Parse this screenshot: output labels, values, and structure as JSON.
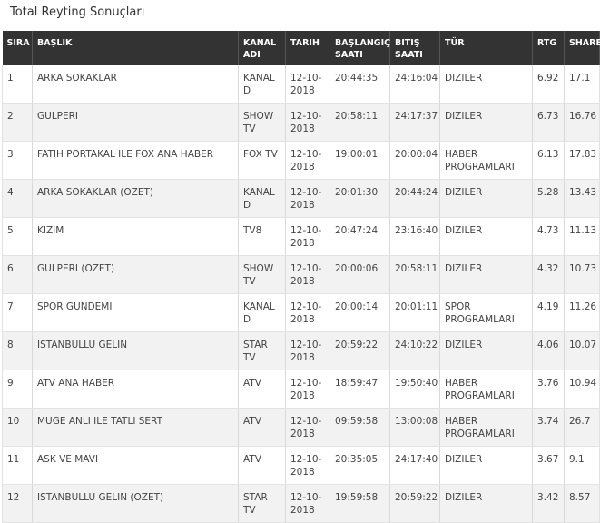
{
  "title": "Total Reyting Sonuçları",
  "headers": [
    "SIRA",
    "BAŞLIK",
    "KANAL ADI",
    "TARIH",
    "BAŞLANGIÇ SAATI",
    "BITIŞ SAATI",
    "TÜR",
    "RTG",
    "SHARE"
  ],
  "rows": [
    [
      "1",
      "ARKA SOKAKLAR",
      "KANAL D",
      "12-10-2018",
      "20:44:35",
      "24:16:04",
      "DIZILER",
      "6.92",
      "17.1"
    ],
    [
      "2",
      "GULPERI",
      "SHOW TV",
      "12-10-2018",
      "20:58:11",
      "24:17:37",
      "DIZILER",
      "6.73",
      "16.76"
    ],
    [
      "3",
      "FATIH PORTAKAL ILE FOX ANA HABER",
      "FOX TV",
      "12-10-2018",
      "19:00:01",
      "20:00:04",
      "HABER PROGRAMLARI",
      "6.13",
      "17.83"
    ],
    [
      "4",
      "ARKA SOKAKLAR (OZET)",
      "KANAL D",
      "12-10-2018",
      "20:01:30",
      "20:44:24",
      "DIZILER",
      "5.28",
      "13.43"
    ],
    [
      "5",
      "KIZIM",
      "TV8",
      "12-10-2018",
      "20:47:24",
      "23:16:40",
      "DIZILER",
      "4.73",
      "11.13"
    ],
    [
      "6",
      "GULPERI (OZET)",
      "SHOW TV",
      "12-10-2018",
      "20:00:06",
      "20:58:11",
      "DIZILER",
      "4.32",
      "10.73"
    ],
    [
      "7",
      "SPOR GUNDEMI",
      "KANAL D",
      "12-10-2018",
      "20:00:14",
      "20:01:11",
      "SPOR PROGRAMLARI",
      "4.19",
      "11.26"
    ],
    [
      "8",
      "ISTANBULLU GELIN",
      "STAR TV",
      "12-10-2018",
      "20:59:22",
      "24:10:22",
      "DIZILER",
      "4.06",
      "10.07"
    ],
    [
      "9",
      "ATV ANA HABER",
      "ATV",
      "12-10-2018",
      "18:59:47",
      "19:50:40",
      "HABER PROGRAMLARI",
      "3.76",
      "10.94"
    ],
    [
      "10",
      "MUGE ANLI ILE TATLI SERT",
      "ATV",
      "12-10-2018",
      "09:59:58",
      "13:00:08",
      "HABER PROGRAMLARI",
      "3.74",
      "26.7"
    ],
    [
      "11",
      "ASK VE MAVI",
      "ATV",
      "12-10-2018",
      "20:35:05",
      "24:17:40",
      "DIZILER",
      "3.67",
      "9.1"
    ],
    [
      "12",
      "ISTANBULLU GELIN (OZET)",
      "STAR TV",
      "12-10-2018",
      "19:59:58",
      "20:59:22",
      "DIZILER",
      "3.42",
      "8.57"
    ]
  ]
}
